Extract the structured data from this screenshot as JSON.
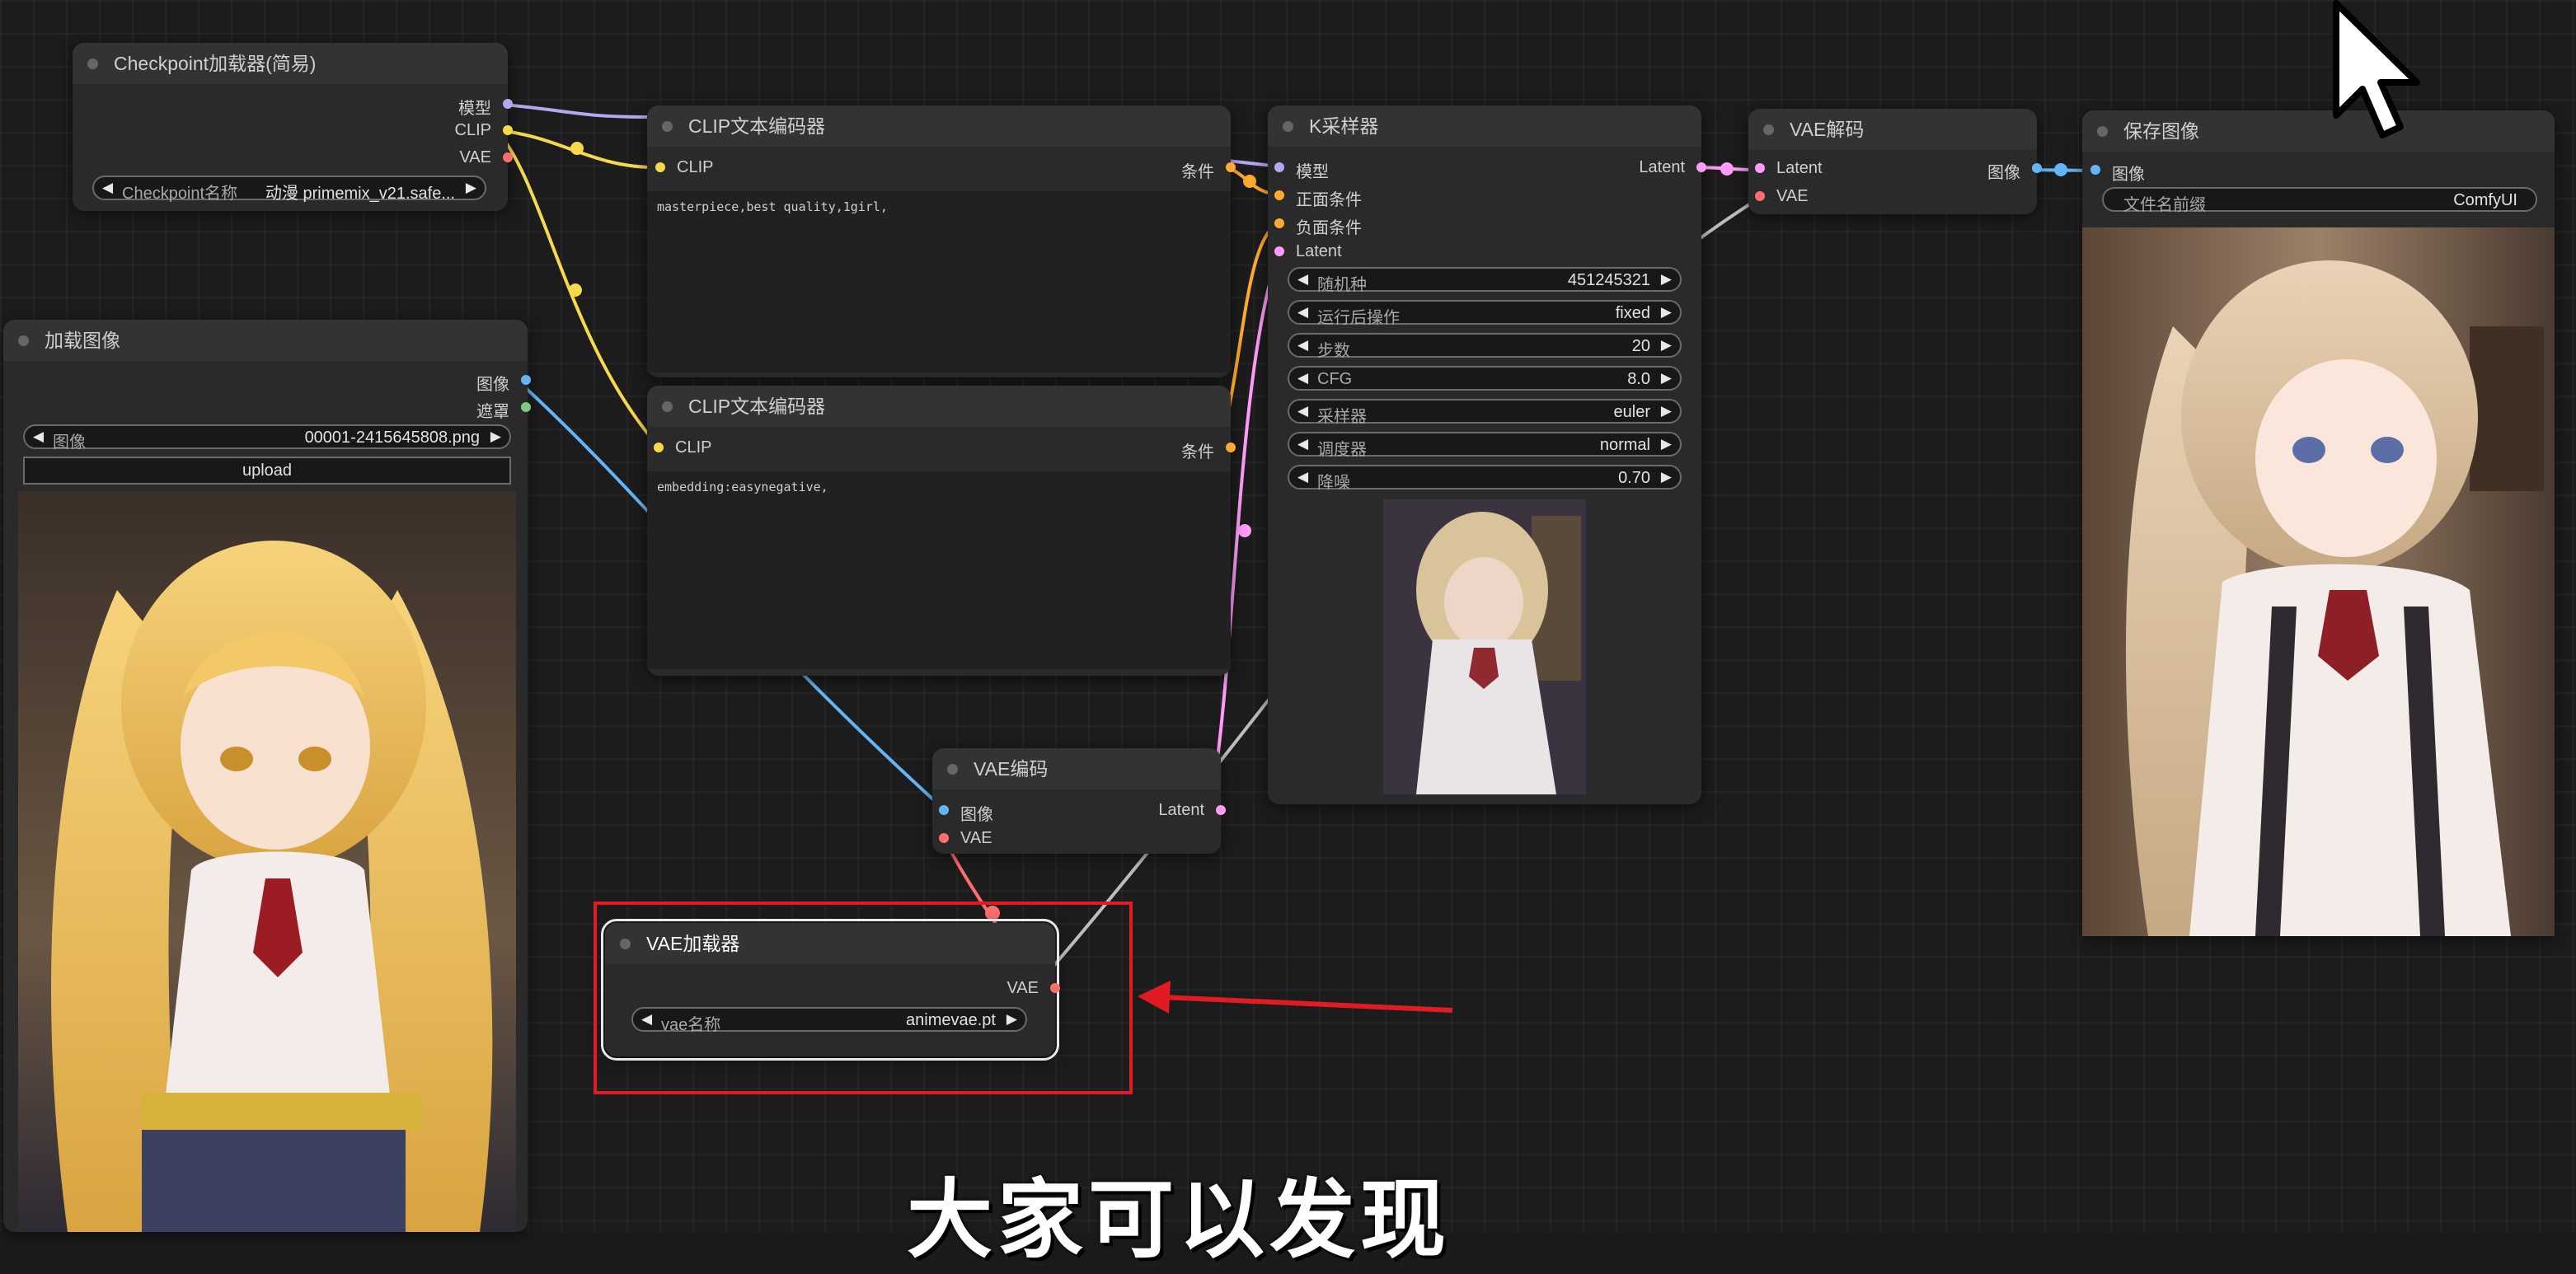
{
  "nodes": {
    "checkpoint_loader": {
      "title": "Checkpoint加载器(简易)",
      "outputs": [
        "模型",
        "CLIP",
        "VAE"
      ],
      "ckpt_widget": {
        "label": "Checkpoint名称",
        "value": "动漫 primemix_v21.safe..."
      }
    },
    "load_image": {
      "title": "加载图像",
      "outputs": [
        "图像",
        "遮罩"
      ],
      "image_widget": {
        "label": "图像",
        "value": "00001-2415645808.png"
      },
      "upload_label": "upload"
    },
    "clip_text_positive": {
      "title": "CLIP文本编码器",
      "input": "CLIP",
      "output": "条件",
      "text": "masterpiece,best quality,1girl,"
    },
    "clip_text_negative": {
      "title": "CLIP文本编码器",
      "input": "CLIP",
      "output": "条件",
      "text": "embedding:easynegative,"
    },
    "ksampler": {
      "title": "K采样器",
      "inputs": [
        "模型",
        "正面条件",
        "负面条件",
        "Latent"
      ],
      "output": "Latent",
      "widgets": [
        {
          "label": "随机种",
          "value": "451245321"
        },
        {
          "label": "运行后操作",
          "value": "fixed"
        },
        {
          "label": "步数",
          "value": "20"
        },
        {
          "label": "CFG",
          "value": "8.0"
        },
        {
          "label": "采样器",
          "value": "euler"
        },
        {
          "label": "调度器",
          "value": "normal"
        },
        {
          "label": "降噪",
          "value": "0.70"
        }
      ]
    },
    "vae_decode": {
      "title": "VAE解码",
      "inputs": [
        "Latent",
        "VAE"
      ],
      "output": "图像"
    },
    "save_image": {
      "title": "保存图像",
      "input": "图像",
      "prefix_widget": {
        "label": "文件名前缀",
        "value": "ComfyUI"
      }
    },
    "vae_encode": {
      "title": "VAE编码",
      "inputs": [
        "图像",
        "VAE"
      ],
      "output": "Latent"
    },
    "vae_loader": {
      "title": "VAE加载器",
      "output": "VAE",
      "vae_widget": {
        "label": "vae名称",
        "value": "animevae.pt"
      }
    }
  },
  "subtitle": "大家可以发现",
  "colors": {
    "model_link": "#b9a6f0",
    "clip_link": "#f7d94c",
    "vae_link": "#ff6e6e",
    "image_link": "#64b5f6",
    "latent_link": "#ff9cf9",
    "conditioning_link": "#ffa931",
    "highlight": "#e01b22"
  },
  "icons": {
    "left_arrow": "◀",
    "right_arrow": "▶",
    "cursor": "mouse-pointer-icon"
  }
}
